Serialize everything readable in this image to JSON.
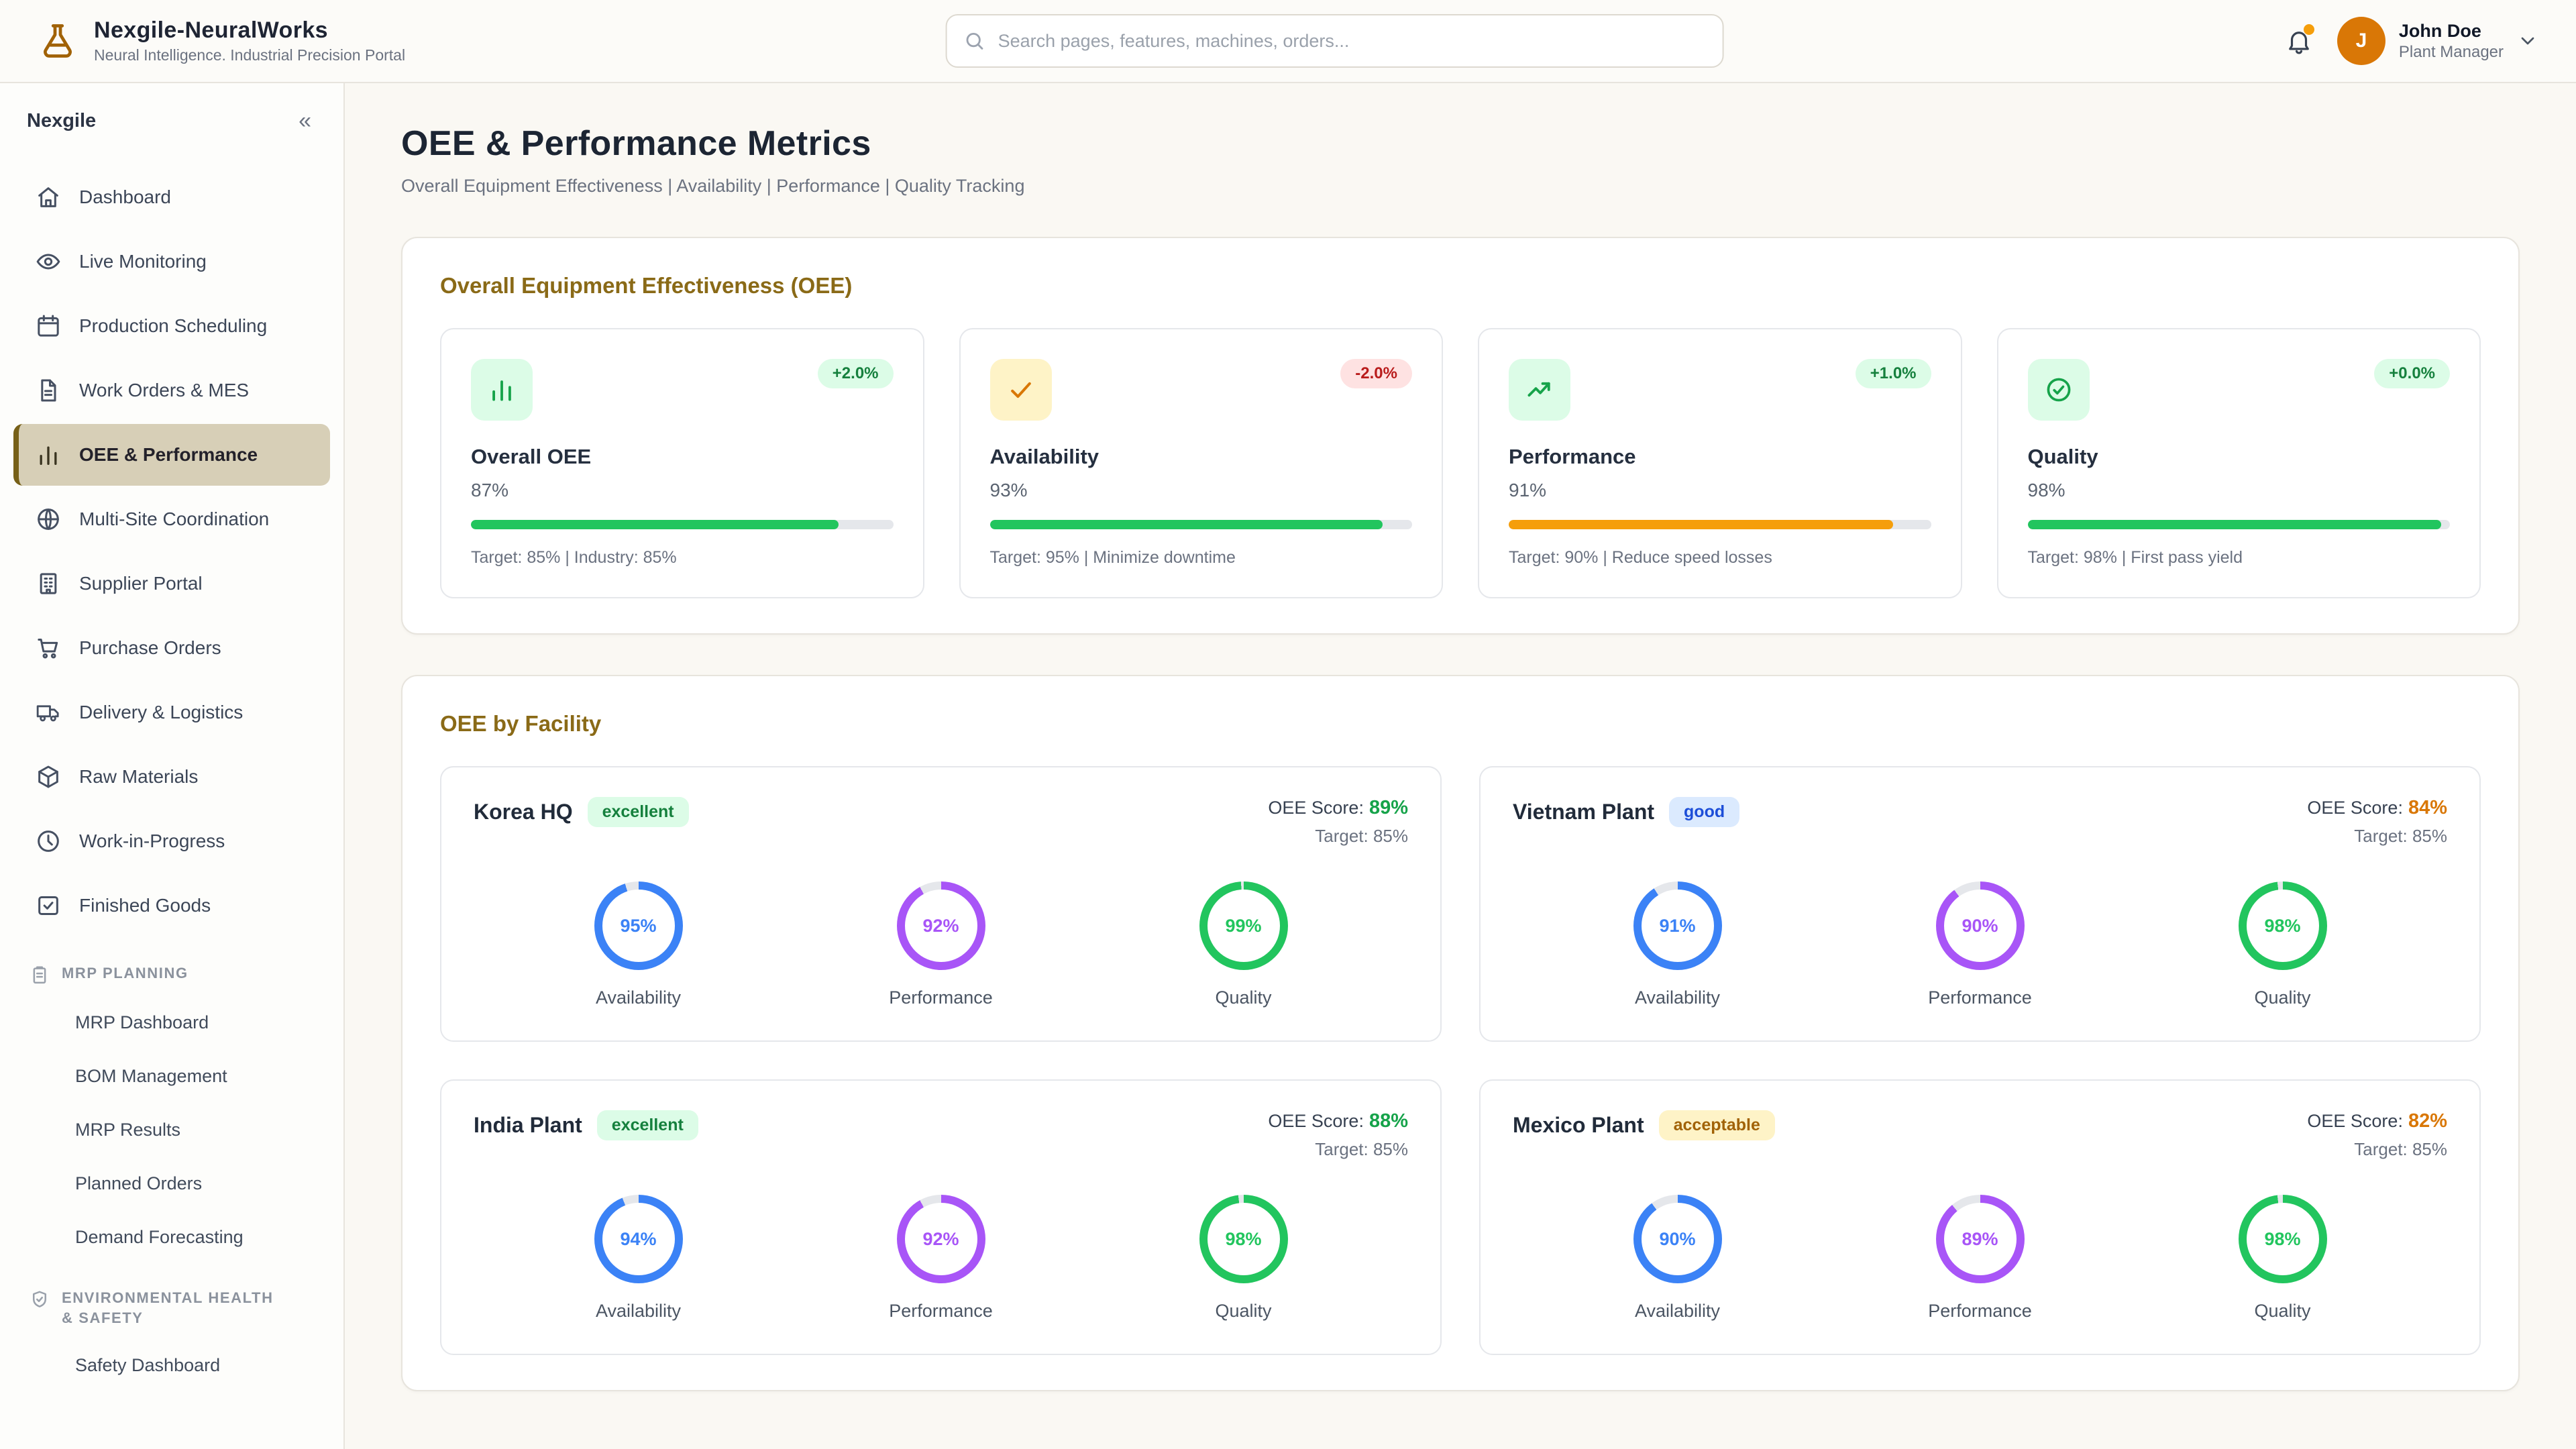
{
  "brand": {
    "title": "Nexgile-NeuralWorks",
    "subtitle": "Neural Intelligence. Industrial Precision Portal"
  },
  "header": {
    "search_placeholder": "Search pages, features, machines, orders...",
    "user": {
      "initial": "J",
      "name": "John Doe",
      "role": "Plant Manager"
    }
  },
  "sidebar": {
    "title": "Nexgile",
    "collapse": "«",
    "items": [
      {
        "label": "Dashboard",
        "icon": "home-icon"
      },
      {
        "label": "Live Monitoring",
        "icon": "eye-icon"
      },
      {
        "label": "Production Scheduling",
        "icon": "calendar-icon"
      },
      {
        "label": "Work Orders & MES",
        "icon": "document-icon"
      },
      {
        "label": "OEE & Performance",
        "icon": "bar-chart-icon"
      },
      {
        "label": "Multi-Site Coordination",
        "icon": "globe-icon"
      },
      {
        "label": "Supplier Portal",
        "icon": "building-icon"
      },
      {
        "label": "Purchase Orders",
        "icon": "cart-icon"
      },
      {
        "label": "Delivery & Logistics",
        "icon": "truck-icon"
      },
      {
        "label": "Raw Materials",
        "icon": "package-icon"
      },
      {
        "label": "Work-in-Progress",
        "icon": "clock-icon"
      },
      {
        "label": "Finished Goods",
        "icon": "box-check-icon"
      }
    ],
    "sections": [
      {
        "title": "MRP PLANNING",
        "icon": "clipboard-icon",
        "items": [
          "MRP Dashboard",
          "BOM Management",
          "MRP Results",
          "Planned Orders",
          "Demand Forecasting"
        ]
      },
      {
        "title": "ENVIRONMENTAL HEALTH & SAFETY",
        "icon": "shield-icon",
        "items": [
          "Safety Dashboard"
        ]
      }
    ]
  },
  "page": {
    "title": "OEE & Performance Metrics",
    "subtitle": "Overall Equipment Effectiveness | Availability | Performance | Quality Tracking"
  },
  "oee_section": {
    "title": "Overall Equipment Effectiveness (OEE)",
    "metrics": [
      {
        "label": "Overall OEE",
        "value": "87%",
        "pct": 87,
        "delta": "+2.0%",
        "delta_bg": "#dcfce7",
        "delta_color": "#15803d",
        "icon_bg": "#dcfce7",
        "icon_color": "#16a34a",
        "bar_color": "#22c55e",
        "target": "Target: 85% | Industry: 85%"
      },
      {
        "label": "Availability",
        "value": "93%",
        "pct": 93,
        "delta": "-2.0%",
        "delta_bg": "#fee2e2",
        "delta_color": "#b91c1c",
        "icon_bg": "#fef3c7",
        "icon_color": "#d97706",
        "bar_color": "#22c55e",
        "target": "Target: 95% | Minimize downtime"
      },
      {
        "label": "Performance",
        "value": "91%",
        "pct": 91,
        "delta": "+1.0%",
        "delta_bg": "#dcfce7",
        "delta_color": "#15803d",
        "icon_bg": "#dcfce7",
        "icon_color": "#16a34a",
        "bar_color": "#f59e0b",
        "target": "Target: 90% | Reduce speed losses"
      },
      {
        "label": "Quality",
        "value": "98%",
        "pct": 98,
        "delta": "+0.0%",
        "delta_bg": "#dcfce7",
        "delta_color": "#15803d",
        "icon_bg": "#dcfce7",
        "icon_color": "#16a34a",
        "bar_color": "#22c55e",
        "target": "Target: 98% | First pass yield"
      }
    ]
  },
  "facility_section": {
    "title": "OEE by Facility",
    "score_label": "OEE Score:",
    "facilities": [
      {
        "name": "Korea HQ",
        "status": "excellent",
        "status_bg": "#dcfce7",
        "status_color": "#15803d",
        "score": "89%",
        "score_color": "#16a34a",
        "target": "Target: 85%",
        "metrics": [
          {
            "label": "Availability",
            "value": "95%",
            "pct": 95,
            "color": "#3b82f6"
          },
          {
            "label": "Performance",
            "value": "92%",
            "pct": 92,
            "color": "#a855f7"
          },
          {
            "label": "Quality",
            "value": "99%",
            "pct": 99,
            "color": "#22c55e"
          }
        ]
      },
      {
        "name": "Vietnam Plant",
        "status": "good",
        "status_bg": "#dbeafe",
        "status_color": "#1d4ed8",
        "score": "84%",
        "score_color": "#d97706",
        "target": "Target: 85%",
        "metrics": [
          {
            "label": "Availability",
            "value": "91%",
            "pct": 91,
            "color": "#3b82f6"
          },
          {
            "label": "Performance",
            "value": "90%",
            "pct": 90,
            "color": "#a855f7"
          },
          {
            "label": "Quality",
            "value": "98%",
            "pct": 98,
            "color": "#22c55e"
          }
        ]
      },
      {
        "name": "India Plant",
        "status": "excellent",
        "status_bg": "#dcfce7",
        "status_color": "#15803d",
        "score": "88%",
        "score_color": "#16a34a",
        "target": "Target: 85%",
        "metrics": [
          {
            "label": "Availability",
            "value": "94%",
            "pct": 94,
            "color": "#3b82f6"
          },
          {
            "label": "Performance",
            "value": "92%",
            "pct": 92,
            "color": "#a855f7"
          },
          {
            "label": "Quality",
            "value": "98%",
            "pct": 98,
            "color": "#22c55e"
          }
        ]
      },
      {
        "name": "Mexico Plant",
        "status": "acceptable",
        "status_bg": "#fef3c7",
        "status_color": "#a16207",
        "score": "82%",
        "score_color": "#d97706",
        "target": "Target: 85%",
        "metrics": [
          {
            "label": "Availability",
            "value": "90%",
            "pct": 90,
            "color": "#3b82f6"
          },
          {
            "label": "Performance",
            "value": "89%",
            "pct": 89,
            "color": "#a855f7"
          },
          {
            "label": "Quality",
            "value": "98%",
            "pct": 98,
            "color": "#22c55e"
          }
        ]
      }
    ]
  }
}
